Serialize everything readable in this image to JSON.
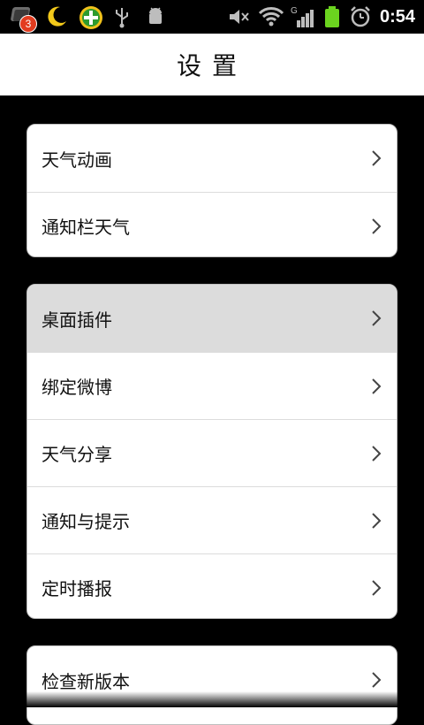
{
  "statusbar": {
    "notification_count": "3",
    "time": "0:54",
    "network_label": "G",
    "icons": [
      "app-notification-icon",
      "moon-icon",
      "security-plus-icon",
      "usb-icon",
      "android-debug-icon",
      "mute-icon",
      "wifi-icon",
      "signal-icon",
      "battery-icon",
      "alarm-icon"
    ]
  },
  "header": {
    "title": "设置"
  },
  "groups": [
    {
      "items": [
        "天气动画",
        "通知栏天气"
      ]
    },
    {
      "items": [
        "桌面插件",
        "绑定微博",
        "天气分享",
        "通知与提示",
        "定时播报"
      ]
    },
    {
      "items": [
        "检查新版本"
      ]
    }
  ]
}
